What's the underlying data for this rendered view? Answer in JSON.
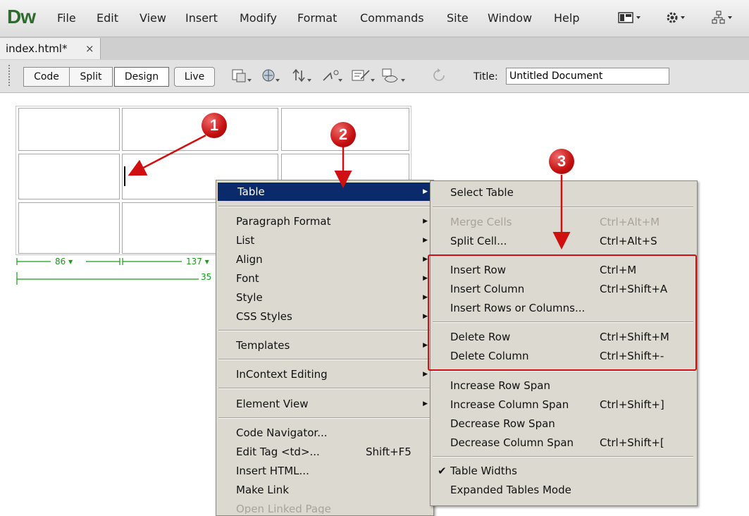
{
  "app": {
    "logo": "Dw"
  },
  "menubar": {
    "items": [
      "File",
      "Edit",
      "View",
      "Insert",
      "Modify",
      "Format",
      "Commands",
      "Site",
      "Window",
      "Help"
    ]
  },
  "tab": {
    "label": "index.html*",
    "close": "×"
  },
  "toolbar": {
    "views": [
      "Code",
      "Split",
      "Design",
      "Live"
    ],
    "active_view": "Design",
    "title_label": "Title:",
    "title_value": "Untitled Document",
    "icons": [
      "multiscreen-icon",
      "preview-icon",
      "file-management-icon",
      "browser-check-icon",
      "validate-icon",
      "visual-aids-icon",
      "refresh-icon"
    ]
  },
  "ruler": {
    "left_width": "86 ▾",
    "mid_width": "137 ▾",
    "total_width": "35"
  },
  "annotations": {
    "one": "1",
    "two": "2",
    "three": "3"
  },
  "context_menu": {
    "items": [
      {
        "label": "Table",
        "arrow": true,
        "highlighted": true
      },
      {
        "label": "Paragraph Format",
        "arrow": true
      },
      {
        "label": "List",
        "arrow": true
      },
      {
        "label": "Align",
        "arrow": true
      },
      {
        "label": "Font",
        "arrow": true
      },
      {
        "label": "Style",
        "arrow": true
      },
      {
        "label": "CSS Styles",
        "arrow": true
      },
      {
        "label": "Templates",
        "arrow": true
      },
      {
        "label": "InContext Editing",
        "arrow": true
      },
      {
        "label": "Element View",
        "arrow": true
      },
      {
        "label": "Code Navigator..."
      },
      {
        "label": "Edit Tag <td>...",
        "shortcut": "Shift+F5"
      },
      {
        "label": "Insert HTML..."
      },
      {
        "label": "Make Link"
      },
      {
        "label": "Open Linked Page",
        "disabled": true
      }
    ]
  },
  "submenu": {
    "items": [
      {
        "label": "Select Table"
      },
      {
        "label": "Merge Cells",
        "shortcut": "Ctrl+Alt+M",
        "disabled": true
      },
      {
        "label": "Split Cell...",
        "shortcut": "Ctrl+Alt+S"
      },
      {
        "label": "Insert Row",
        "shortcut": "Ctrl+M"
      },
      {
        "label": "Insert Column",
        "shortcut": "Ctrl+Shift+A"
      },
      {
        "label": "Insert Rows or Columns..."
      },
      {
        "label": "Delete Row",
        "shortcut": "Ctrl+Shift+M"
      },
      {
        "label": "Delete Column",
        "shortcut": "Ctrl+Shift+-"
      },
      {
        "label": "Increase Row Span"
      },
      {
        "label": "Increase Column Span",
        "shortcut": "Ctrl+Shift+]"
      },
      {
        "label": "Decrease Row Span"
      },
      {
        "label": "Decrease Column Span",
        "shortcut": "Ctrl+Shift+["
      },
      {
        "label": "Table Widths",
        "checked": true
      },
      {
        "label": "Expanded Tables Mode"
      }
    ]
  },
  "colors": {
    "highlight": "#0b2a6b",
    "menu_bg": "#dcd9d0",
    "annotation_red": "#d01010",
    "ruler_green": "#1a9a1a"
  }
}
